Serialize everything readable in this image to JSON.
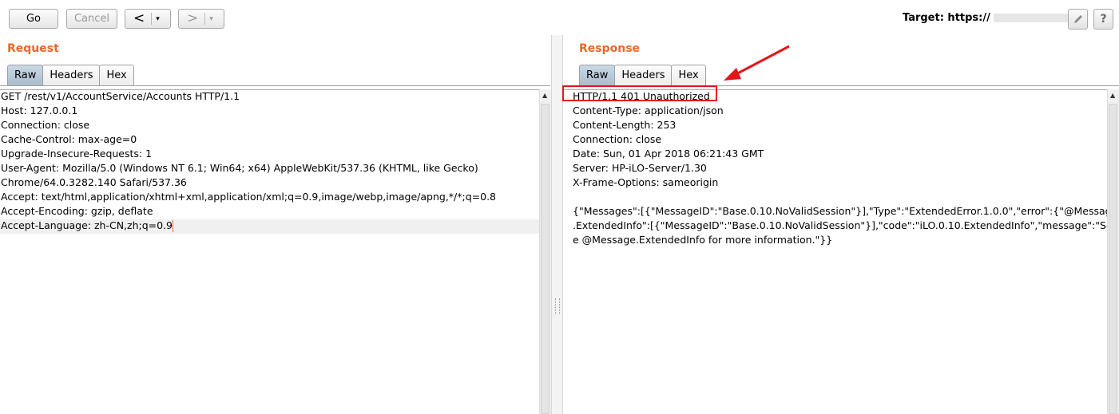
{
  "toolbar": {
    "go_label": "Go",
    "cancel_label": "Cancel",
    "back_arrow": "<",
    "forward_arrow": ">",
    "dropdown_glyph": "▾",
    "target_label": "Target: https://",
    "edit_icon": "pencil-icon",
    "help_label": "?"
  },
  "request": {
    "title": "Request",
    "tabs": [
      "Raw",
      "Headers",
      "Hex"
    ],
    "active_tab": "Raw",
    "lines": [
      "GET /rest/v1/AccountService/Accounts HTTP/1.1",
      "Host: 127.0.0.1",
      "Connection: close",
      "Cache-Control: max-age=0",
      "Upgrade-Insecure-Requests: 1",
      "User-Agent: Mozilla/5.0 (Windows NT 6.1; Win64; x64) AppleWebKit/537.36 (KHTML, like Gecko)",
      "Chrome/64.0.3282.140 Safari/537.36",
      "Accept: text/html,application/xhtml+xml,application/xml;q=0.9,image/webp,image/apng,*/*;q=0.8",
      "Accept-Encoding: gzip, deflate",
      "Accept-Language: zh-CN,zh;q=0.9"
    ]
  },
  "response": {
    "title": "Response",
    "tabs": [
      "Raw",
      "Headers",
      "Hex"
    ],
    "active_tab": "Raw",
    "lines": [
      "HTTP/1.1 401 Unauthorized",
      "Content-Type: application/json",
      "Content-Length: 253",
      "Connection: close",
      "Date: Sun, 01 Apr 2018 06:21:43 GMT",
      "Server: HP-iLO-Server/1.30",
      "X-Frame-Options: sameorigin",
      "",
      "{\"Messages\":[{\"MessageID\":\"Base.0.10.NoValidSession\"}],\"Type\":\"ExtendedError.1.0.0\",\"error\":{\"@Message",
      ".ExtendedInfo\":[{\"MessageID\":\"Base.0.10.NoValidSession\"}],\"code\":\"iLO.0.10.ExtendedInfo\",\"message\":\"Se",
      "e @Message.ExtendedInfo for more information.\"}}"
    ]
  },
  "annotation": {
    "color": "#e8141b"
  },
  "colors": {
    "accent": "#e8692f",
    "active_tab": "#aabdce"
  }
}
